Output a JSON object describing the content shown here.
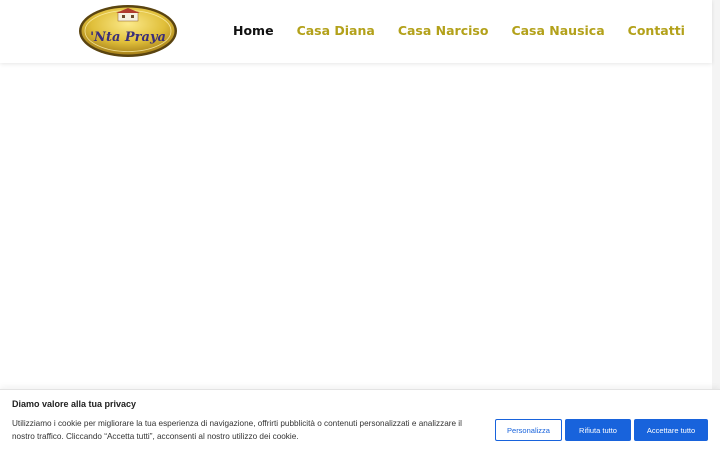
{
  "header": {
    "logo": {
      "icon": "nta-praya-logo",
      "text": "'Nta Praya"
    },
    "nav": [
      {
        "label": "Home",
        "active": true
      },
      {
        "label": "Casa Diana",
        "active": false
      },
      {
        "label": "Casa Narciso",
        "active": false
      },
      {
        "label": "Casa Nausica",
        "active": false
      },
      {
        "label": "Contatti",
        "active": false
      }
    ]
  },
  "cookie_banner": {
    "title": "Diamo valore alla tua privacy",
    "text": "Utilizziamo i cookie per migliorare la tua esperienza di navigazione, offrirti pubblicità o contenuti personalizzati e analizzare il nostro traffico. Cliccando “Accetta tutti”, acconsenti al nostro utilizzo dei cookie.",
    "buttons": {
      "customize": "Personalizza",
      "reject": "Rifiuta tutto",
      "accept": "Accettare tutto"
    }
  },
  "colors": {
    "nav_link": "#b3a11a",
    "nav_active": "#111111",
    "button_blue": "#1863dc",
    "logo_gold": "#e0bf3a",
    "logo_text": "#3a2e7a"
  }
}
